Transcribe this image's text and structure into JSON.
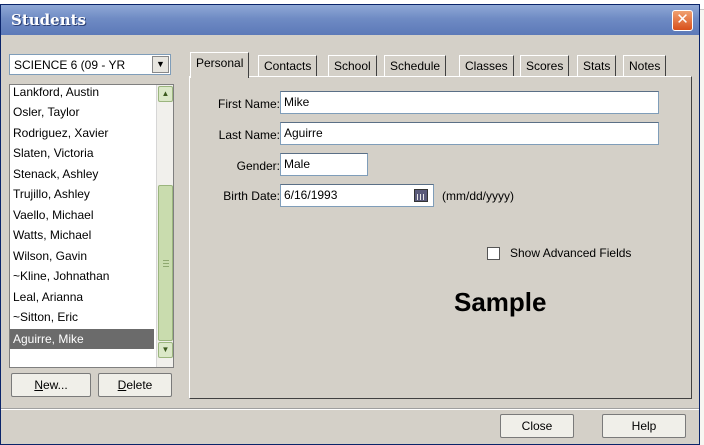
{
  "window": {
    "title": "Students"
  },
  "class_selector": {
    "value": "SCIENCE 6 (09 - YR"
  },
  "students": [
    "Lankford, Austin",
    "Osler, Taylor",
    "Rodriguez, Xavier",
    "Slaten, Victoria",
    "Stenack, Ashley",
    "Trujillo, Ashley",
    "Vaello, Michael",
    "Watts, Michael",
    "Wilson, Gavin",
    "~Kline, Johnathan",
    "Leal, Arianna",
    "~Sitton, Eric",
    "Aguirre, Mike"
  ],
  "selected_student": "Aguirre, Mike",
  "buttons": {
    "new": "New...",
    "delete": "Delete",
    "close": "Close",
    "help": "Help"
  },
  "tabs": [
    "Personal",
    "Contacts",
    "School",
    "Schedule",
    "Classes",
    "Scores",
    "Stats",
    "Notes"
  ],
  "active_tab": "Personal",
  "form": {
    "first_name": {
      "label": "First Name:",
      "value": "Mike"
    },
    "last_name": {
      "label": "Last Name:",
      "value": "Aguirre"
    },
    "gender": {
      "label": "Gender:",
      "value": "Male"
    },
    "birth_date": {
      "label": "Birth Date:",
      "value": "6/16/1993",
      "hint": "(mm/dd/yyyy)"
    }
  },
  "advanced": {
    "label": "Show Advanced Fields",
    "checked": false
  },
  "watermark": "Sample",
  "icons": [
    "close-icon",
    "dropdown-arrow-icon",
    "scroll-up-icon",
    "scroll-down-icon",
    "calendar-icon"
  ],
  "colors": {
    "titlebar": "#6f8bc4",
    "selection": "#6b6b6b",
    "close_button": "#d8501c"
  }
}
